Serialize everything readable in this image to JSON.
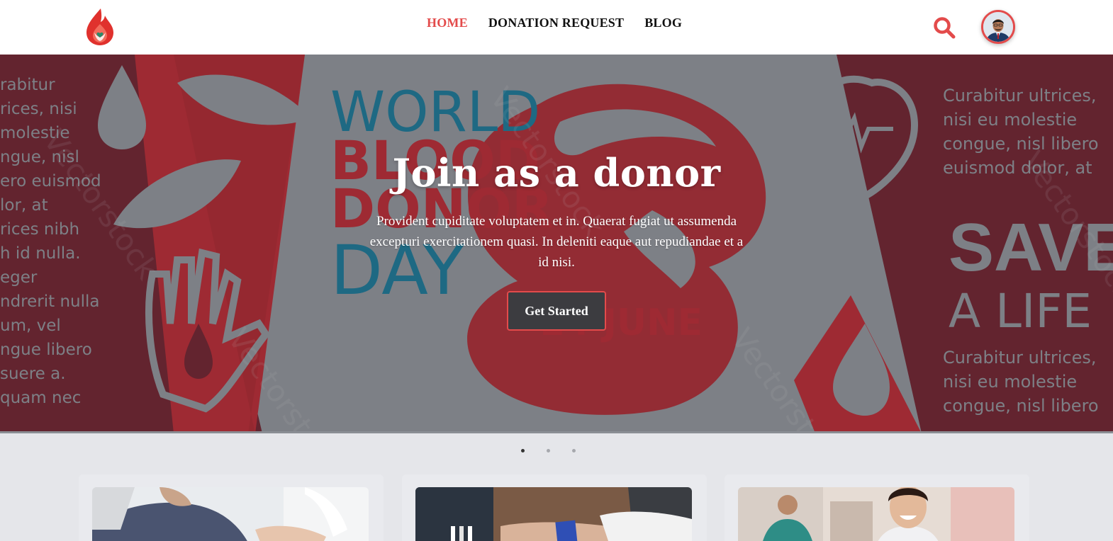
{
  "nav": {
    "logo_icon": "blood-drop-flame-logo",
    "links": [
      {
        "label": "HOME",
        "active": true
      },
      {
        "label": "DONATION REQUEST",
        "active": false
      },
      {
        "label": "BLOG",
        "active": false
      }
    ],
    "search_icon": "search-icon",
    "avatar_icon": "user-avatar"
  },
  "hero": {
    "title": "Join as a donor",
    "text": "Provident cupiditate voluptatem et in. Quaerat fugiat ut assumenda excepturi exercitationem quasi. In deleniti eaque aut repudiandae et a id nisi.",
    "cta_label": "Get Started",
    "banner": {
      "world": "WORLD",
      "blood": "BLOOD",
      "donor": "DONOR",
      "day": "DAY",
      "date": "14 JUNE",
      "save": "SAVE",
      "a_life": "A LIFE",
      "left_copy": [
        "rabitur",
        "rices, nisi",
        "molestie",
        "ngue, nisl",
        "ero euismod",
        "lor, at",
        "rices nibh",
        "h id nulla.",
        "eger",
        "ndrerit nulla",
        "um, vel",
        "ngue libero",
        "suere a.",
        "quam nec"
      ],
      "right_copy_top": [
        "Curabitur ultrices,",
        "nisi eu molestie",
        "congue, nisl libero",
        "euismod dolor, at"
      ],
      "right_copy_bottom": [
        "Curabitur ultrices,",
        "nisi eu molestie",
        "congue, nisl libero"
      ],
      "watermark": "Vectorstock"
    }
  },
  "carousel": {
    "slides": 3,
    "active_index": 0
  },
  "cards": [
    {
      "image": "patient-donating-blood-photo"
    },
    {
      "image": "arm-with-tourniquet-photo"
    },
    {
      "image": "nurse-smiling-photo"
    }
  ],
  "colors": {
    "accent": "#e34b4b",
    "banner_dark_red": "#7d2330",
    "banner_red": "#d12c35",
    "banner_blue": "#1b86a8"
  }
}
